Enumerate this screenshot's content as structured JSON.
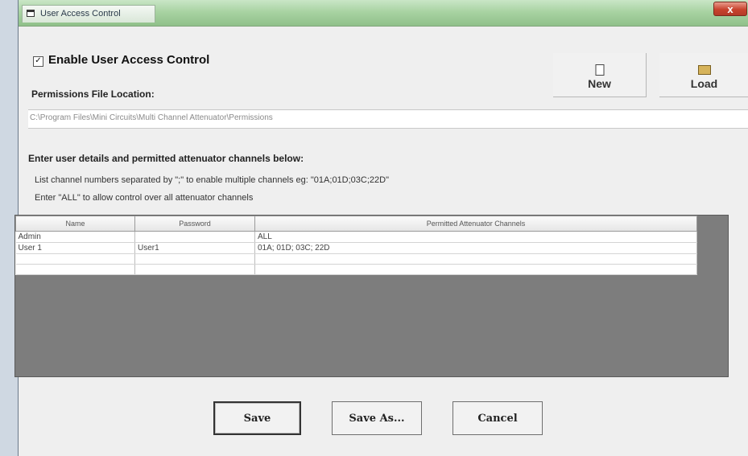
{
  "window": {
    "title": "User Access Control",
    "close_glyph": "x"
  },
  "enable": {
    "checked": true,
    "check_glyph": "✓",
    "label": "Enable User Access Control"
  },
  "permissions": {
    "label": "Permissions File Location:",
    "path": "C:\\Program Files\\Mini Circuits\\Multi Channel Attenuator\\Permissions"
  },
  "toolbar": {
    "new_label": "New",
    "new_icon": "document-icon",
    "load_label": "Load",
    "load_icon": "folder-open-icon"
  },
  "instructions": {
    "heading": "Enter user details and permitted attenuator channels below:",
    "line1": "List channel numbers separated by \";\" to enable multiple channels eg: \"01A;01D;03C;22D\"",
    "line2": "Enter \"ALL\" to allow control over all attenuator channels"
  },
  "grid": {
    "columns": [
      "Name",
      "Password",
      "Permitted Attenuator Channels"
    ],
    "rows": [
      [
        "Admin",
        "",
        "ALL"
      ],
      [
        "User 1",
        "User1",
        "01A; 01D; 03C; 22D"
      ],
      [
        "",
        "",
        ""
      ],
      [
        "",
        "",
        ""
      ]
    ]
  },
  "buttons": {
    "save": "Save",
    "save_as": "Save As...",
    "cancel": "Cancel"
  },
  "colors": {
    "titlebar": "#a9d3a3",
    "close": "#c8432e",
    "grid_background": "#7d7d7d"
  }
}
